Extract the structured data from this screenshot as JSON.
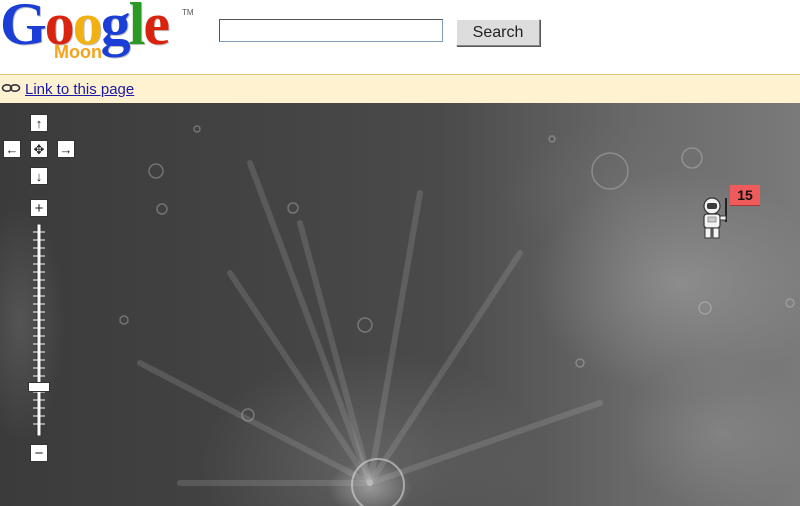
{
  "header": {
    "logo_text": "Google",
    "logo_sub": "Moon",
    "logo_tm": "TM",
    "search_value": "",
    "search_button": "Search"
  },
  "linkbar": {
    "label": "Link to this page",
    "icon": "link-icon"
  },
  "map": {
    "controls": {
      "pan_up": "↑",
      "pan_left": "←",
      "pan_center": "✥",
      "pan_right": "→",
      "pan_down": "↓",
      "zoom_in": "+",
      "zoom_out": "−"
    },
    "zoom_level_fraction": 0.22,
    "marker": {
      "label": "15",
      "icon": "astronaut-icon",
      "color": "#f05a5a"
    }
  },
  "colors": {
    "link": "#1a1aa6",
    "linkbar_bg": "#fff2d0",
    "logo_blue": "#1b3fd6",
    "logo_red": "#d9230f",
    "logo_yellow": "#f2b110",
    "logo_green": "#2a9a24",
    "moon_orange": "#f5a31a"
  }
}
